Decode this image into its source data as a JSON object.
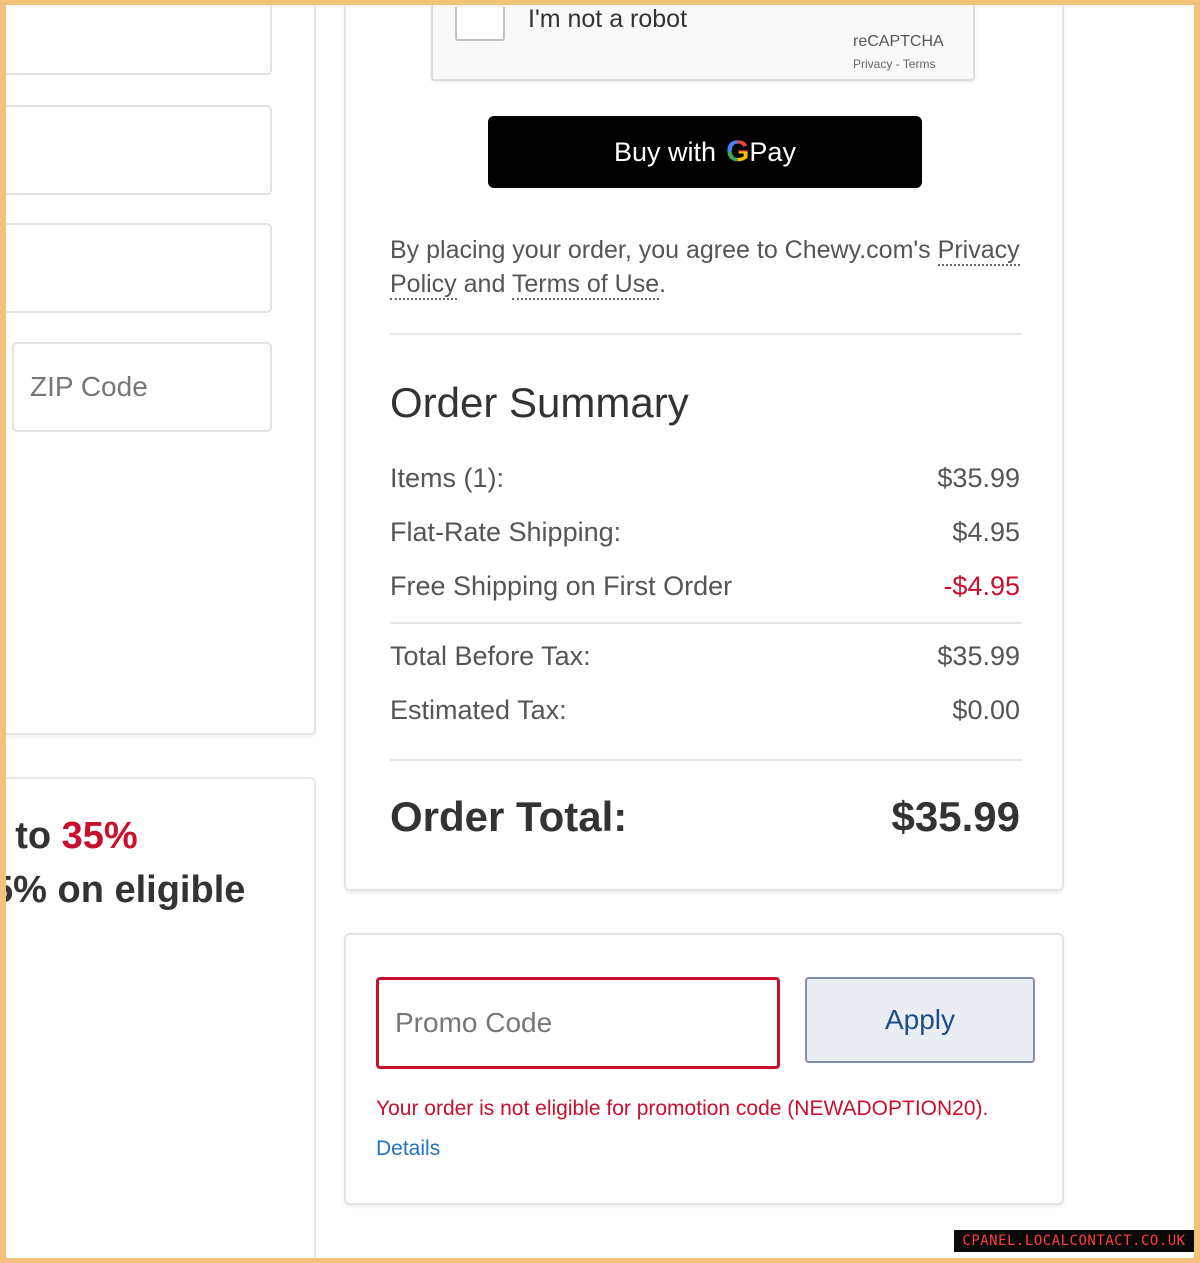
{
  "left": {
    "zip_placeholder": "ZIP Code",
    "promo_line1_prefix": ") to ",
    "promo_line1_highlight": "35%",
    "promo_line2": "5% on eligible"
  },
  "recaptcha": {
    "label": "I'm not a robot",
    "brand": "reCAPTCHA",
    "links": "Privacy - Terms"
  },
  "gpay": {
    "prefix": "Buy with",
    "g": "G",
    "pay": "Pay"
  },
  "agreement": {
    "text_before": "By placing your order, you agree to Chewy.com's ",
    "privacy_link": "Privacy Policy",
    "and": " and ",
    "terms_link": "Terms of Use",
    "period": "."
  },
  "summary": {
    "title": "Order Summary",
    "rows": [
      {
        "label": "Items (1):",
        "value": "$35.99"
      },
      {
        "label": "Flat-Rate Shipping:",
        "value": "$4.95"
      },
      {
        "label": "Free Shipping on First Order",
        "value": "-$4.95"
      },
      {
        "label": "Total Before Tax:",
        "value": "$35.99"
      },
      {
        "label": "Estimated Tax:",
        "value": "$0.00"
      }
    ],
    "total_label": "Order Total:",
    "total_value": "$35.99"
  },
  "promo": {
    "placeholder": "Promo Code",
    "apply_label": "Apply",
    "error": "Your order is not eligible for promotion code (NEWADOPTION20).",
    "details_label": "Details"
  },
  "watermark": "CPANEL.LOCALCONTACT.CO.UK",
  "colors": {
    "frame": "#f0c27a",
    "error_red": "#c8102e",
    "link_blue": "#1e73be"
  }
}
